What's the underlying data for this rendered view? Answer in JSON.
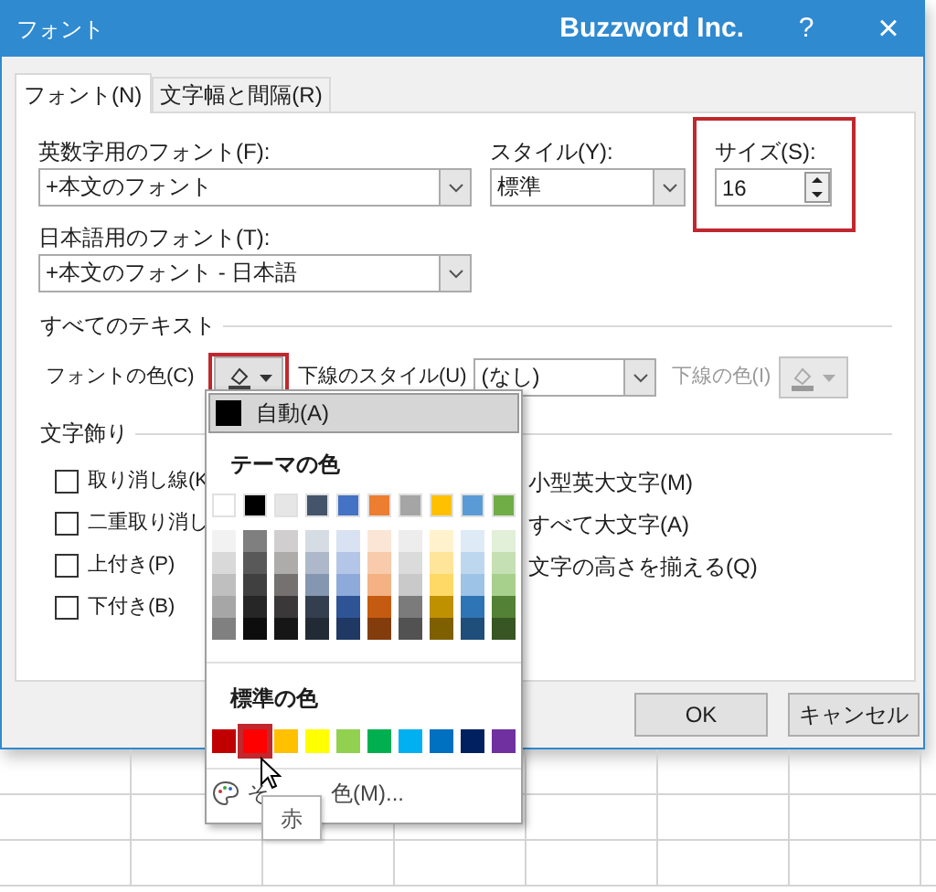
{
  "window": {
    "title": "フォント",
    "company": "Buzzword Inc.",
    "help": "?",
    "close": "×"
  },
  "tabs": [
    {
      "label": "フォント(N)",
      "selected": true
    },
    {
      "label": "文字幅と間隔(R)",
      "selected": false
    }
  ],
  "latin_font": {
    "label": "英数字用のフォント(F):",
    "value": "+本文のフォント"
  },
  "style": {
    "label": "スタイル(Y):",
    "value": "標準"
  },
  "size": {
    "label": "サイズ(S):",
    "value": "16"
  },
  "japanese_font": {
    "label": "日本語用のフォント(T):",
    "value": "+本文のフォント - 日本語"
  },
  "all_text": {
    "heading": "すべてのテキスト",
    "font_color_label": "フォントの色(C)",
    "underline_style_label": "下線のスタイル(U)",
    "underline_style_value": "(なし)",
    "underline_color_label": "下線の色(I)",
    "underline_color_disabled": true
  },
  "effects": {
    "heading": "文字飾り",
    "left": [
      {
        "label": "取り消し線(K",
        "checked": false
      },
      {
        "label": "二重取り消し",
        "checked": false
      },
      {
        "label": "上付き(P)",
        "checked": false
      },
      {
        "label": "下付き(B)",
        "checked": false
      }
    ],
    "right": [
      {
        "label": "小型英大文字(M)"
      },
      {
        "label": "すべて大文字(A)"
      },
      {
        "label": "文字の高さを揃える(Q)"
      }
    ]
  },
  "buttons": [
    "OK",
    "キャンセル"
  ],
  "color_menu": {
    "automatic": {
      "label": "自動(A)",
      "color": "#000000"
    },
    "theme_heading": "テーマの色",
    "theme_colors": [
      {
        "color": "#ffffff",
        "shades": [
          {
            "color": "#f2f2f2"
          },
          {
            "color": "#d9d9d9"
          },
          {
            "color": "#bfbfbf"
          },
          {
            "color": "#a6a6a6"
          },
          {
            "color": "#808080"
          }
        ]
      },
      {
        "color": "#000000",
        "shades": [
          {
            "color": "#7f7f7f"
          },
          {
            "color": "#595959"
          },
          {
            "color": "#404040"
          },
          {
            "color": "#262626"
          },
          {
            "color": "#0d0d0d"
          }
        ]
      },
      {
        "color": "#e7e6e6",
        "shades": [
          {
            "color": "#d0cece"
          },
          {
            "color": "#aeabab"
          },
          {
            "color": "#757171"
          },
          {
            "color": "#3a3838"
          },
          {
            "color": "#171616"
          }
        ]
      },
      {
        "color": "#44546a",
        "shades": [
          {
            "color": "#d6dce4"
          },
          {
            "color": "#adb9ca"
          },
          {
            "color": "#8496b0"
          },
          {
            "color": "#333f4f"
          },
          {
            "color": "#222a35"
          }
        ]
      },
      {
        "color": "#4472c4",
        "shades": [
          {
            "color": "#d9e2f3"
          },
          {
            "color": "#b4c6e7"
          },
          {
            "color": "#8eaadb"
          },
          {
            "color": "#2f5496"
          },
          {
            "color": "#1f3864"
          }
        ]
      },
      {
        "color": "#ed7d31",
        "shades": [
          {
            "color": "#fbe5d5"
          },
          {
            "color": "#f7cbac"
          },
          {
            "color": "#f4b183"
          },
          {
            "color": "#c55a11"
          },
          {
            "color": "#833c0b"
          }
        ]
      },
      {
        "color": "#a5a5a5",
        "shades": [
          {
            "color": "#ededed"
          },
          {
            "color": "#dbdbdb"
          },
          {
            "color": "#c9c9c9"
          },
          {
            "color": "#7b7b7b"
          },
          {
            "color": "#525252"
          }
        ]
      },
      {
        "color": "#ffc000",
        "shades": [
          {
            "color": "#fff2cc"
          },
          {
            "color": "#fee599"
          },
          {
            "color": "#ffd965"
          },
          {
            "color": "#bf9000"
          },
          {
            "color": "#7f6000"
          }
        ]
      },
      {
        "color": "#5b9bd5",
        "shades": [
          {
            "color": "#deebf6"
          },
          {
            "color": "#bdd7ee"
          },
          {
            "color": "#9dc3e6"
          },
          {
            "color": "#2e75b5"
          },
          {
            "color": "#1e4e79"
          }
        ]
      },
      {
        "color": "#70ad47",
        "shades": [
          {
            "color": "#e2efd9"
          },
          {
            "color": "#c5e0b3"
          },
          {
            "color": "#a8d08d"
          },
          {
            "color": "#538135"
          },
          {
            "color": "#375623"
          }
        ]
      }
    ],
    "standard_heading": "標準の色",
    "standard_colors": [
      {
        "color": "#c00000",
        "selected": false
      },
      {
        "color": "#ff0000",
        "selected": true
      },
      {
        "color": "#ffc000",
        "selected": false
      },
      {
        "color": "#ffff00",
        "selected": false
      },
      {
        "color": "#92d050",
        "selected": false
      },
      {
        "color": "#00b050",
        "selected": false
      },
      {
        "color": "#00b0f0",
        "selected": false
      },
      {
        "color": "#0070c0",
        "selected": false
      },
      {
        "color": "#002060",
        "selected": false
      },
      {
        "color": "#7030a0",
        "selected": false
      }
    ],
    "more_colors_start": "そ",
    "more_colors_end": "色(M)..."
  },
  "tooltip": "赤"
}
